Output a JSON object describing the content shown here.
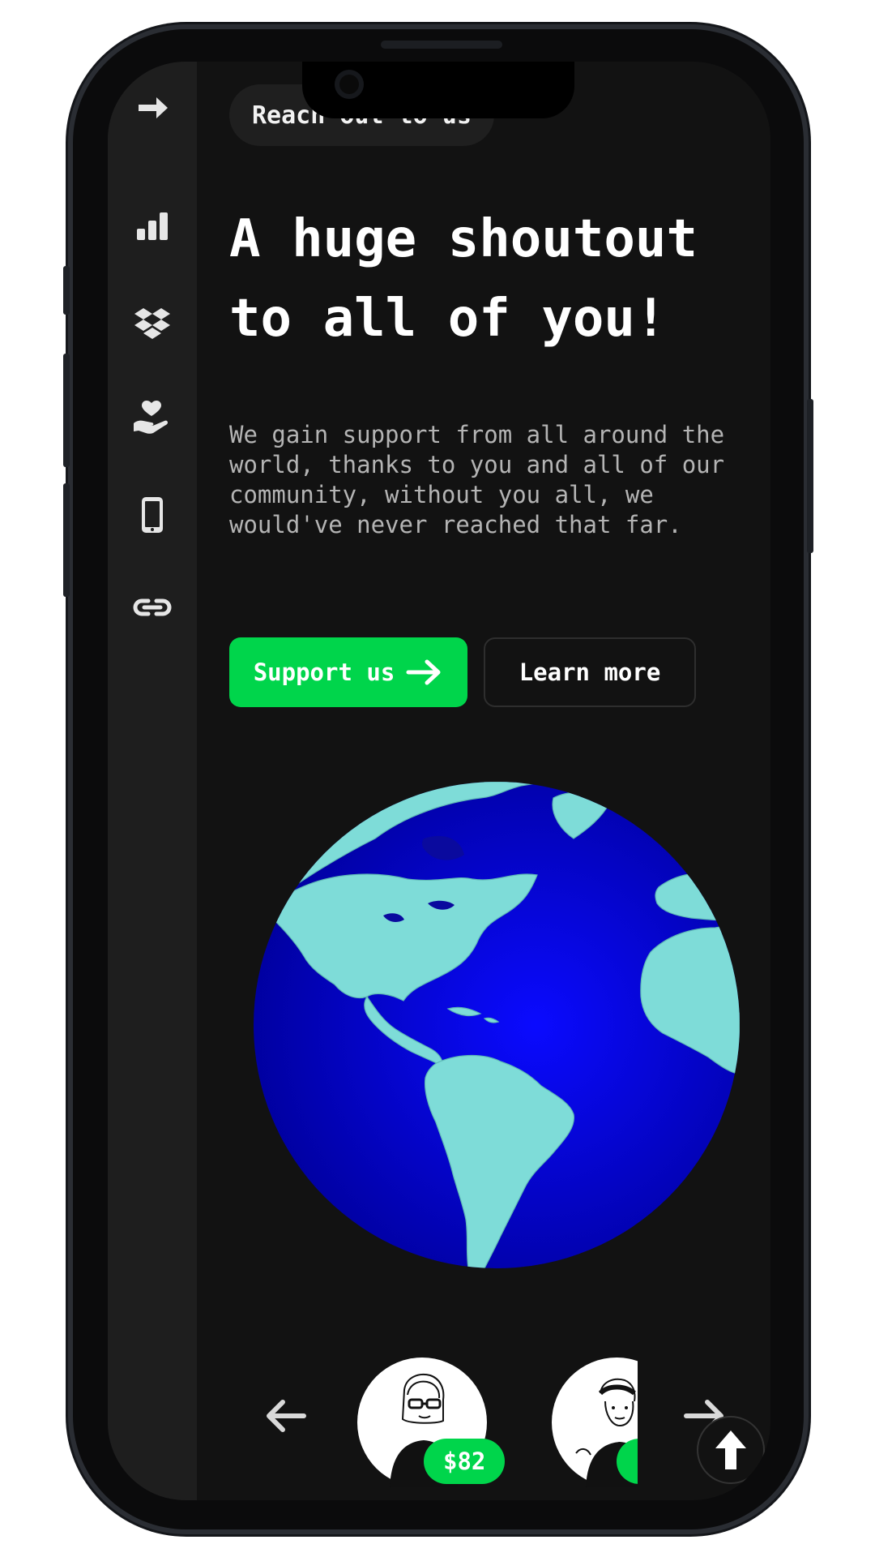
{
  "nav": {
    "items": [
      {
        "icon": "arrow-right-icon",
        "label": "expand"
      },
      {
        "icon": "bar-chart-icon",
        "label": "stats"
      },
      {
        "icon": "dropbox-icon",
        "label": "dropbox"
      },
      {
        "icon": "hand-heart-icon",
        "label": "donate"
      },
      {
        "icon": "mobile-icon",
        "label": "mobile"
      },
      {
        "icon": "link-icon",
        "label": "links"
      }
    ]
  },
  "contact_pill": "Reach out to us",
  "hero": {
    "headline": "A huge shoutout to all of you!",
    "description": "We gain support from all around the world, thanks to you and all of our community, without you all, we would've never reached that far."
  },
  "actions": {
    "support_label": "Support us",
    "learn_label": "Learn more"
  },
  "supporters": [
    {
      "amount": "$82"
    },
    {
      "amount": "$"
    }
  ],
  "colors": {
    "accent": "#00d54b",
    "background": "#121212",
    "sidebar": "#1e1e1e",
    "ocean": "#0000d8",
    "land": "#7edcd8"
  }
}
